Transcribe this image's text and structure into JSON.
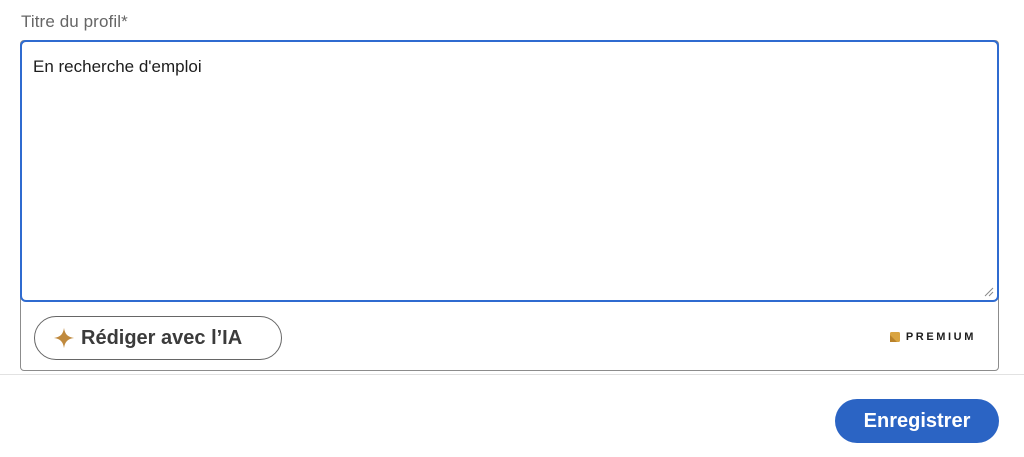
{
  "form": {
    "headline_label": "Titre du profil*",
    "headline_value": "En recherche d'emploi"
  },
  "ai_assist": {
    "button_label": "Rédiger avec l’IA",
    "icon": "sparkle-icon"
  },
  "premium": {
    "label": "PREMIUM",
    "icon": "premium-icon"
  },
  "footer": {
    "save_label": "Enregistrer"
  },
  "colors": {
    "focus_border": "#2f6bd0",
    "primary_button": "#2b64c4",
    "sparkle": "#c08a3e",
    "premium_gold": "#d9a441"
  }
}
